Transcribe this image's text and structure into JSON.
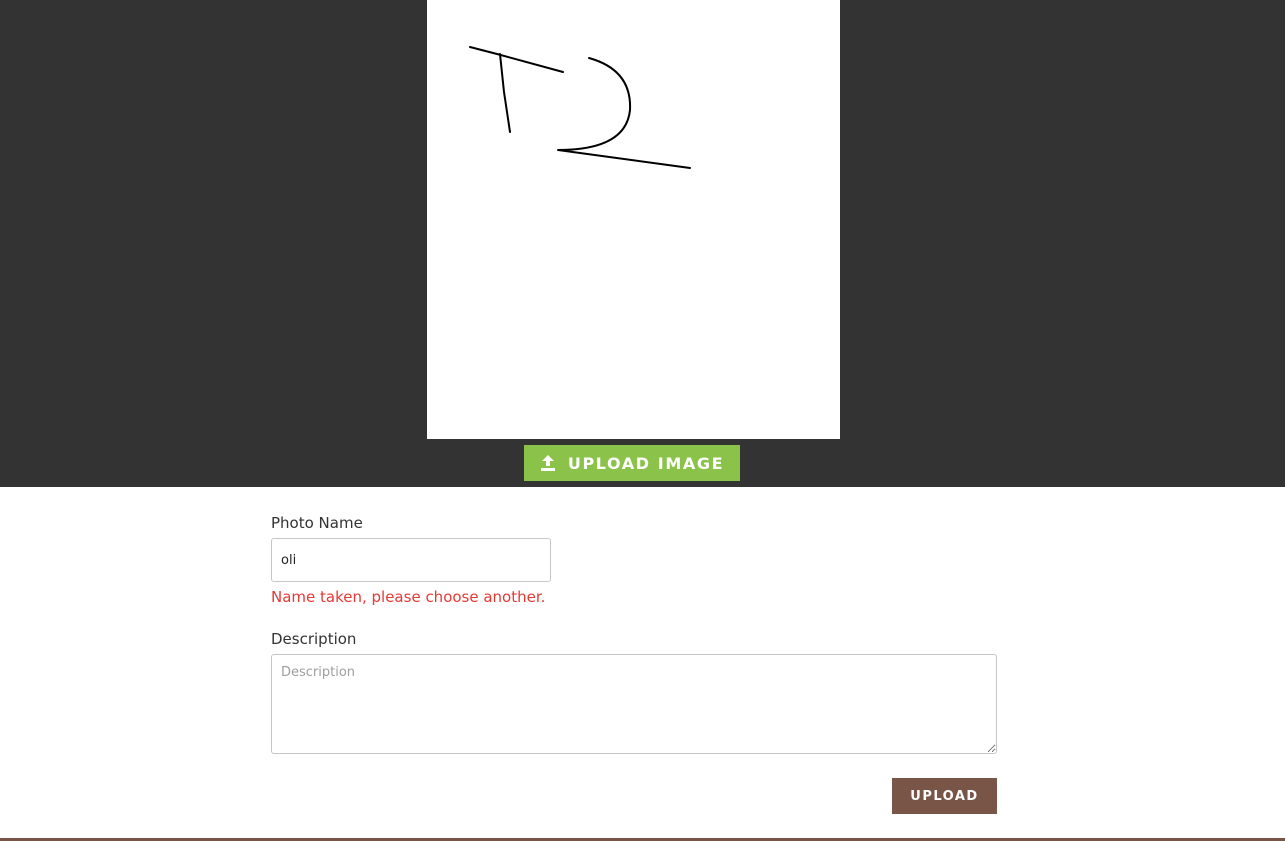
{
  "colors": {
    "panel_background": "#333333",
    "accent_green": "#8bc34a",
    "brown": "#795548",
    "error": "#e53935"
  },
  "image_panel": {
    "upload_image_label": "UPLOAD IMAGE",
    "upload_icon": "upload-icon"
  },
  "form": {
    "photo_name_label": "Photo Name",
    "photo_name_value": "oli",
    "photo_name_error": "Name taken, please choose another.",
    "description_label": "Description",
    "description_placeholder": "Description",
    "description_value": "",
    "upload_label": "UPLOAD"
  }
}
